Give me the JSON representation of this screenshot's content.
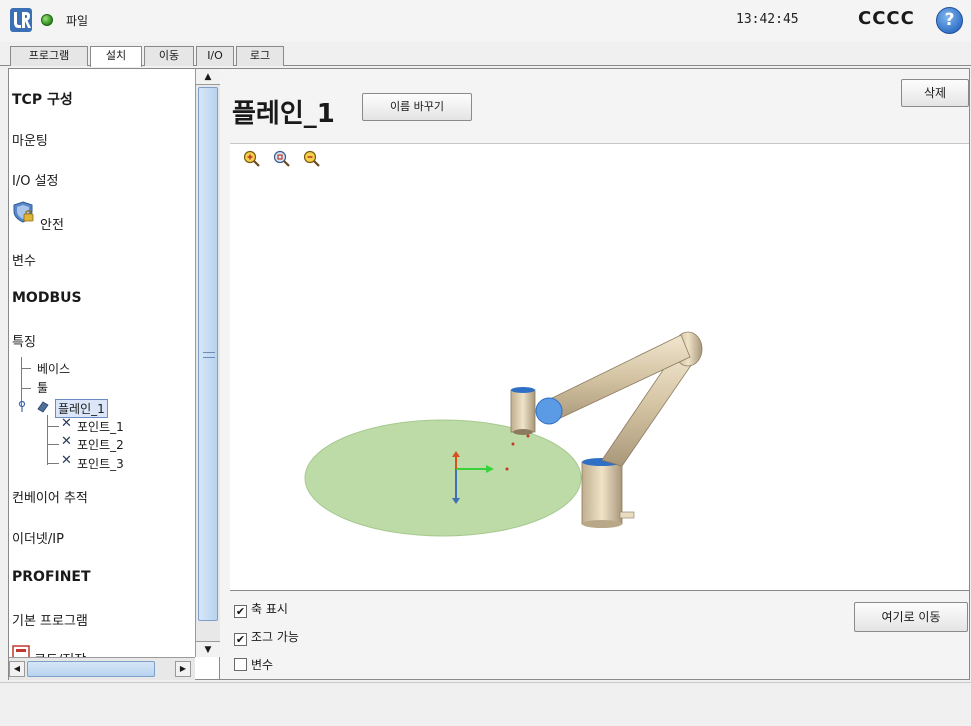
{
  "topbar": {
    "file_label": "파일",
    "clock": "13:42:45",
    "robot_name": "CCCC",
    "help_glyph": "?",
    "status_color": "#2a8a1a"
  },
  "tabs": [
    {
      "label": "프로그램",
      "active": false
    },
    {
      "label": "설치",
      "active": true
    },
    {
      "label": "이동",
      "active": false
    },
    {
      "label": "I/O",
      "active": false
    },
    {
      "label": "로그",
      "active": false
    }
  ],
  "sidebar": {
    "items": [
      {
        "label": "TCP 구성"
      },
      {
        "label": "마운팅"
      },
      {
        "label": "I/O 설정"
      },
      {
        "label": "안전"
      },
      {
        "label": "변수"
      },
      {
        "label": "MODBUS"
      },
      {
        "label": "특징"
      },
      {
        "label": "컨베이어 추적"
      },
      {
        "label": "이더넷/IP"
      },
      {
        "label": "PROFINET"
      },
      {
        "label": "기본 프로그램"
      },
      {
        "label": "로드/저장"
      }
    ],
    "tree": {
      "base": "베이스",
      "tool": "툴",
      "plane": "플레인_1",
      "points": [
        "포인트_1",
        "포인트_2",
        "포인트_3"
      ]
    },
    "icons": {
      "shield": "shield-lock-icon",
      "plane": "plane-feature-icon",
      "point": "x-point-icon"
    }
  },
  "main": {
    "title": "플레인_1",
    "rename_label": "이름 바꾸기",
    "delete_label": "삭제",
    "move_here_label": "여기로 이동",
    "checks": [
      {
        "label": "축 표시",
        "checked": true
      },
      {
        "label": "조그 가능",
        "checked": true
      },
      {
        "label": "변수",
        "checked": false
      }
    ],
    "check_glyph": "✔",
    "zoom_icons": [
      "zoom-in-icon",
      "zoom-reset-icon",
      "zoom-out-icon"
    ]
  },
  "colors": {
    "plane_fill": "#bddba6",
    "robot_body": "#d9ccb0",
    "joint_cap": "#2f6fc4",
    "accent": "#4a90d9"
  }
}
